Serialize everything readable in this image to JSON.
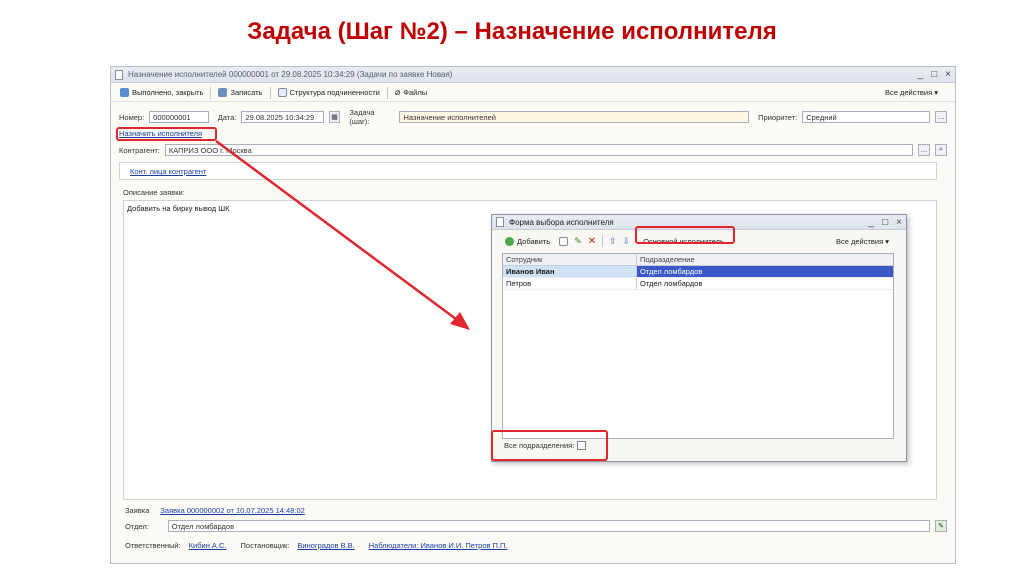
{
  "slide": {
    "title": "Задача (Шаг №2) – Назначение исполнителя"
  },
  "window": {
    "title": "Назначение исполнителей 000000001 от 29.08.2025 10:34:29 (Задачи по заявке Новая)",
    "controls": [
      "_",
      "□",
      "×"
    ]
  },
  "toolbar": {
    "done_close": "Выполнено, закрыть",
    "save": "Записать",
    "structure": "Структура подчиненности",
    "files": "Файлы",
    "all_actions": "Все действия ▾"
  },
  "header": {
    "number_label": "Номер:",
    "number_value": "000000001",
    "date_label": "Дата:",
    "date_value": "29.08.2025 10:34:29",
    "task_label": "Задача (шаг):",
    "task_value": "Назначение исполнителей",
    "priority_label": "Приоритет:",
    "priority_value": "Средний"
  },
  "assign_link": "Назначить исполнителя",
  "counterparty": {
    "label": "Контрагент:",
    "value": "КАПРИЗ ООО г. Москва"
  },
  "contacts_link": "Конт. лица контрагент",
  "description": {
    "label": "Описание заявки:",
    "text": "Добавить на бирку вывод ШК"
  },
  "footer": {
    "request_label": "Заявка",
    "request_link": "Заявка 000000002 от 10.07.2025 14:48:02",
    "dept_label": "Отдел:",
    "dept_value": "Отдел ломбардов",
    "responsible_label": "Ответственный:",
    "responsible_value": "Кибин А.С.",
    "assigner_label": "Постановщик:",
    "assigner_value": "Виноградов В.В.",
    "observers_link": "Наблюдатели: Иванов И.И. Петров П.П."
  },
  "dialog": {
    "title": "Форма выбора исполнителя",
    "add": "Добавить",
    "main_executor": "Основной исполнитель",
    "all_actions": "Все действия ▾",
    "columns": [
      "Сотрудник",
      "Подразделение"
    ],
    "rows": [
      {
        "employee": "Иванов Иван",
        "department": "Отдел ломбардов"
      },
      {
        "employee": "Петров",
        "department": "Отдел ломбардов"
      }
    ],
    "all_depts_label": "Все подразделения:"
  },
  "colors": {
    "accent_red": "#e0262f",
    "title_red": "#c00000",
    "selection_blue": "#3a59c7"
  }
}
